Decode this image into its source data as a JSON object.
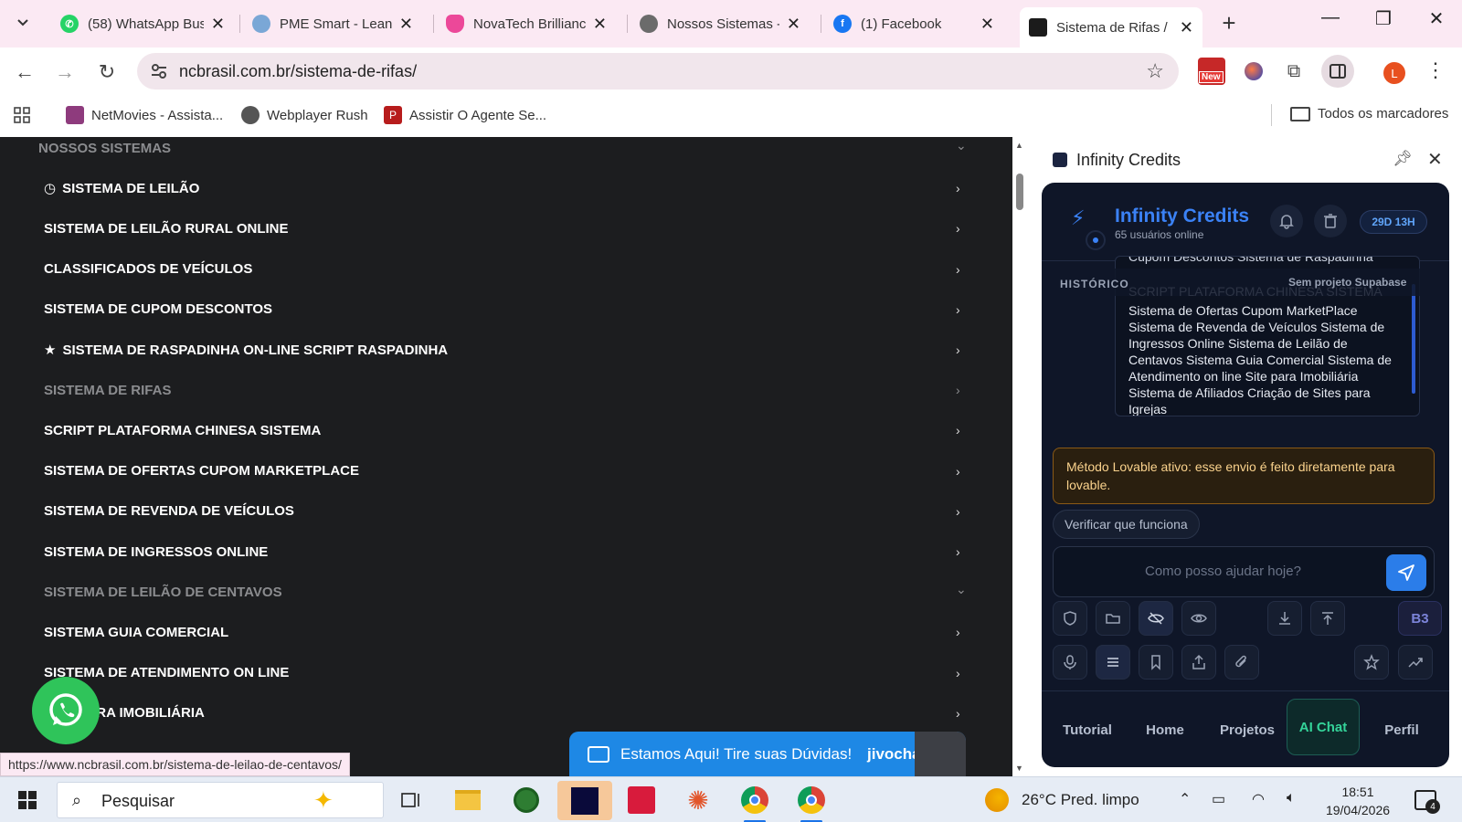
{
  "browser": {
    "tabs": [
      {
        "title": "(58) WhatsApp Bus",
        "icon": "whatsapp-icon",
        "color": "#25d366"
      },
      {
        "title": "PME Smart - Leanc",
        "icon": "globe-icon",
        "color": "#7aa7d6"
      },
      {
        "title": "NovaTech Brillianc",
        "icon": "heart-icon",
        "color": "#ec4899"
      },
      {
        "title": "Nossos Sistemas -",
        "icon": "globe-icon",
        "color": "#6b6b6b"
      },
      {
        "title": "(1) Facebook",
        "icon": "facebook-icon",
        "color": "#1877f2"
      },
      {
        "title": "Sistema de Rifas /",
        "icon": "site-icon",
        "color": "#1b1b1b"
      }
    ],
    "url": "ncbrasil.com.br/sistema-de-rifas/",
    "ext_new_badge": "New",
    "profile_initial": "L",
    "bookmarks": [
      {
        "label": "NetMovies - Assista...",
        "icon": "netmovies-icon"
      },
      {
        "label": "Webplayer Rush",
        "icon": "globe-icon"
      },
      {
        "label": "Assistir O Agente Se...",
        "icon": "p-icon"
      }
    ],
    "all_bookmarks": "Todos os marcadores",
    "status_url": "https://www.ncbrasil.com.br/sistema-de-leilao-de-centavos/"
  },
  "page": {
    "menu": [
      {
        "label": "NOSSOS SISTEMAS",
        "muted": true,
        "chevron": "down",
        "prefix": ""
      },
      {
        "label": "SISTEMA DE LEILÃO",
        "muted": false,
        "chevron": "right",
        "prefix": "clock"
      },
      {
        "label": "SISTEMA DE LEILÃO RURAL ONLINE",
        "muted": false,
        "chevron": "right",
        "prefix": ""
      },
      {
        "label": "CLASSIFICADOS DE VEÍCULOS",
        "muted": false,
        "chevron": "right",
        "prefix": ""
      },
      {
        "label": "SISTEMA DE CUPOM DESCONTOS",
        "muted": false,
        "chevron": "right",
        "prefix": ""
      },
      {
        "label": "SISTEMA DE RASPADINHA ON-LINE SCRIPT RASPADINHA",
        "muted": false,
        "chevron": "right",
        "prefix": "star"
      },
      {
        "label": "SISTEMA DE RIFAS",
        "muted": true,
        "chevron": "right",
        "prefix": ""
      },
      {
        "label": "SCRIPT PLATAFORMA CHINESA SISTEMA",
        "muted": false,
        "chevron": "right",
        "prefix": ""
      },
      {
        "label": "SISTEMA DE OFERTAS CUPOM MARKETPLACE",
        "muted": false,
        "chevron": "right",
        "prefix": ""
      },
      {
        "label": "SISTEMA DE REVENDA DE VEÍCULOS",
        "muted": false,
        "chevron": "right",
        "prefix": ""
      },
      {
        "label": "SISTEMA DE INGRESSOS ONLINE",
        "muted": false,
        "chevron": "right",
        "prefix": ""
      },
      {
        "label": "SISTEMA DE LEILÃO DE CENTAVOS",
        "muted": true,
        "chevron": "down",
        "prefix": ""
      },
      {
        "label": "SISTEMA GUIA COMERCIAL",
        "muted": false,
        "chevron": "right",
        "prefix": ""
      },
      {
        "label": "SISTEMA DE ATENDIMENTO ON LINE",
        "muted": false,
        "chevron": "right",
        "prefix": ""
      },
      {
        "label": "SITE PARA IMOBILIÁRIA",
        "muted": false,
        "chevron": "right",
        "prefix": ""
      }
    ],
    "chat_banner": "Estamos Aqui! Tire suas Dúvidas!",
    "chat_brand": "jivochat"
  },
  "side_panel": {
    "title": "Infinity Credits",
    "app": {
      "title": "Infinity Credits",
      "online": "65 usuários online",
      "timer": "29D 13H",
      "history_label": "HISTÓRICO",
      "supabase_label": "Sem projeto Supabase",
      "message_cut_top": "Cupom Descontos Sistema de Raspadinha",
      "message_cut_mid": "SCRIPT PLATAFORMA CHINESA SISTEMA",
      "message_body": "Sistema de Ofertas Cupom MarketPlace Sistema de Revenda de Veículos Sistema de Ingressos Online Sistema de Leilão de Centavos Sistema Guia Comercial Sistema de Atendimento on line Site para Imobiliária Sistema de Afiliados Criação de Sites para Igrejas",
      "notice": "Método Lovable ativo: esse envio é feito diretamente para lovable.",
      "verify_btn": "Verificar que funciona",
      "input_placeholder": "Como posso ajudar hoje?",
      "b3_label": "B3",
      "nav": [
        "Tutorial",
        "Home",
        "Projetos",
        "AI Chat",
        "Perfil"
      ],
      "active_nav": "AI Chat"
    }
  },
  "taskbar": {
    "search_label": "Pesquisar",
    "weather": "26°C  Pred. limpo",
    "time": "18:51",
    "date": "19/04/2026",
    "notifications": "4"
  }
}
